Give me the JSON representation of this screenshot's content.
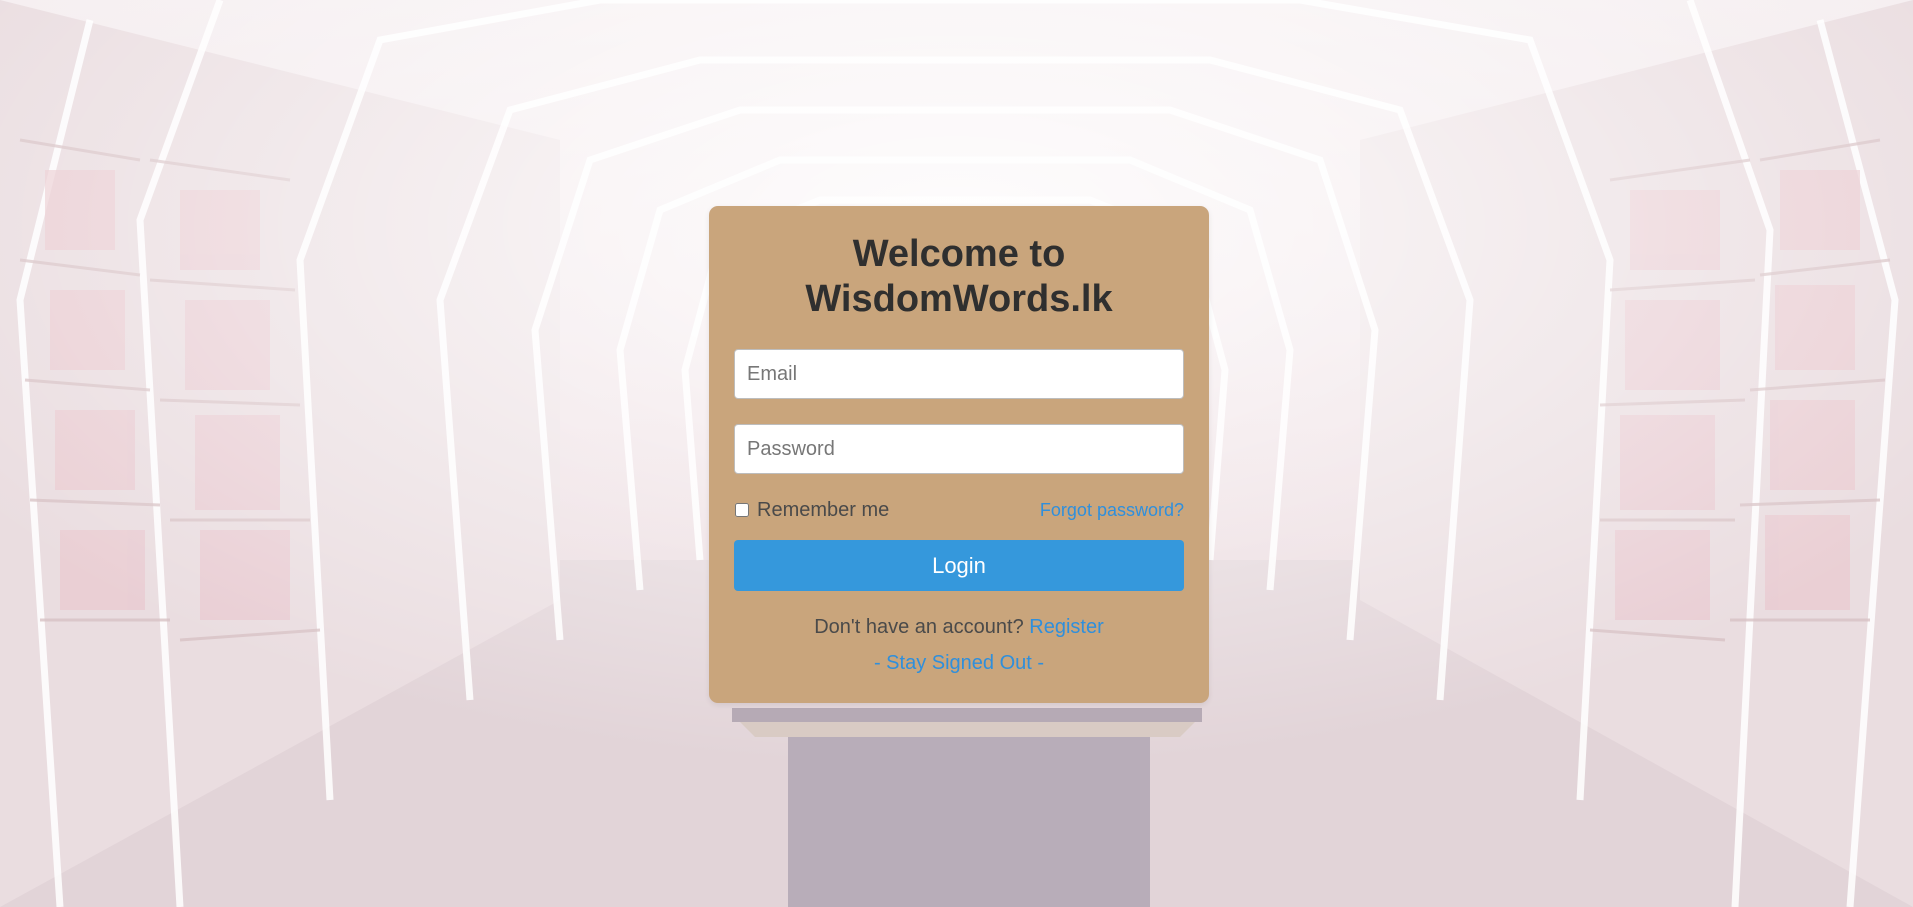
{
  "page": {
    "background": "bookstore-shelves-photo",
    "card_color": "#c9a57c",
    "accent_color": "#3598dc",
    "link_color": "#2f8fdc"
  },
  "login_card": {
    "title_line1": "Welcome to",
    "title_line2": "WisdomWords.lk",
    "email_placeholder": "Email",
    "password_placeholder": "Password",
    "remember_label": "Remember me",
    "forgot_label": "Forgot password?",
    "login_label": "Login",
    "register_prompt": "Don't have an account?",
    "register_label": "Register",
    "signout_label": "- Stay Signed Out -"
  }
}
